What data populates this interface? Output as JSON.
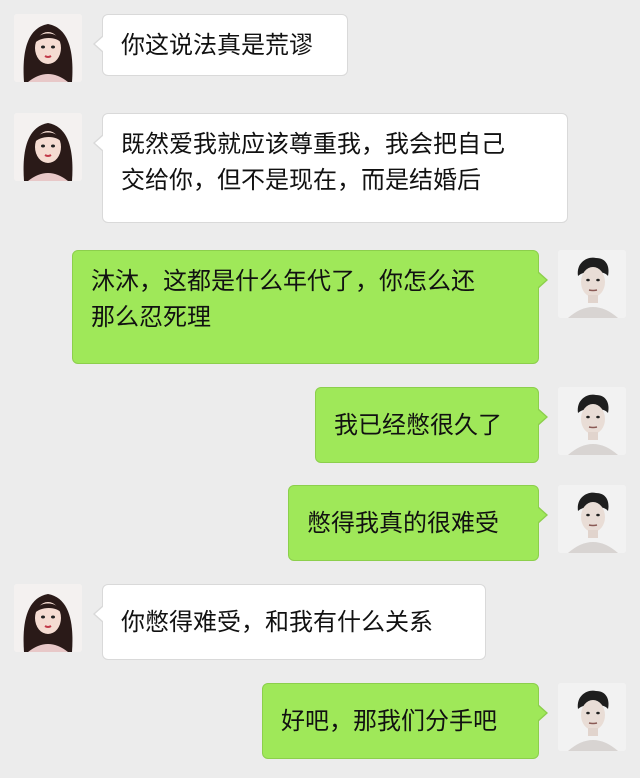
{
  "chat": {
    "messages": [
      {
        "side": "left",
        "avatar": "female-avatar",
        "lines": [
          "你这说法真是荒谬"
        ]
      },
      {
        "side": "left",
        "avatar": "female-avatar",
        "lines": [
          "既然爱我就应该尊重我，我会把自己",
          "交给你，但不是现在，而是结婚后"
        ]
      },
      {
        "side": "right",
        "avatar": "male-avatar",
        "lines": [
          "沐沐，这都是什么年代了，你怎么还",
          "那么忍死理"
        ]
      },
      {
        "side": "right",
        "avatar": "male-avatar",
        "lines": [
          "我已经憋很久了"
        ]
      },
      {
        "side": "right",
        "avatar": "male-avatar",
        "lines": [
          "憋得我真的很难受"
        ]
      },
      {
        "side": "left",
        "avatar": "female-avatar",
        "lines": [
          "你憋得难受，和我有什么关系"
        ]
      },
      {
        "side": "right",
        "avatar": "male-avatar",
        "lines": [
          "好吧，那我们分手吧"
        ]
      }
    ]
  },
  "colors": {
    "background": "#ececec",
    "incoming_bubble": "#ffffff",
    "outgoing_bubble": "#9fe859"
  }
}
